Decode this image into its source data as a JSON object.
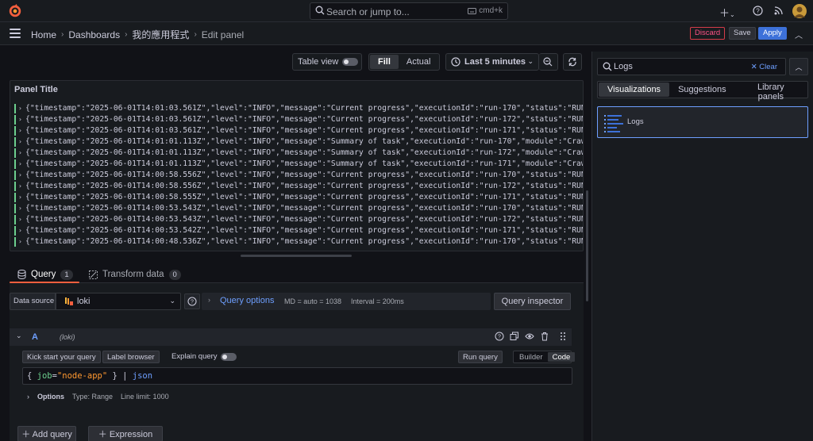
{
  "topbar": {
    "search_placeholder": "Search or jump to...",
    "search_shortcut": "cmd+k",
    "icons": [
      "grafana-logo-icon",
      "search-icon",
      "keyboard-icon",
      "plus-icon",
      "help-icon",
      "rss-icon",
      "avatar"
    ]
  },
  "breadcrumb": {
    "items": [
      "Home",
      "Dashboards",
      "我的應用程式",
      "Edit panel"
    ]
  },
  "actions": {
    "discard": "Discard",
    "save": "Save",
    "apply": "Apply"
  },
  "toolbar": {
    "table_view": "Table view",
    "fill": "Fill",
    "actual": "Actual",
    "time_range": "Last 5 minutes"
  },
  "panel": {
    "title": "Panel Title",
    "log_rows": [
      "{\"timestamp\":\"2025-06-01T14:01:03.561Z\",\"level\":\"INFO\",\"message\":\"Current progress\",\"executionId\":\"run-170\",\"status\":\"RUNNING\",\"module\":",
      "{\"timestamp\":\"2025-06-01T14:01:03.561Z\",\"level\":\"INFO\",\"message\":\"Current progress\",\"executionId\":\"run-172\",\"status\":\"RUNNING\",\"module\":",
      "{\"timestamp\":\"2025-06-01T14:01:03.561Z\",\"level\":\"INFO\",\"message\":\"Current progress\",\"executionId\":\"run-171\",\"status\":\"RUNNING\",\"module\":",
      "{\"timestamp\":\"2025-06-01T14:01:01.113Z\",\"level\":\"INFO\",\"message\":\"Summary of task\",\"executionId\":\"run-170\",\"module\":\"Crawler-C\",\"numToPr",
      "{\"timestamp\":\"2025-06-01T14:01:01.113Z\",\"level\":\"INFO\",\"message\":\"Summary of task\",\"executionId\":\"run-172\",\"module\":\"Crawler-B\",\"numToPr",
      "{\"timestamp\":\"2025-06-01T14:01:01.113Z\",\"level\":\"INFO\",\"message\":\"Summary of task\",\"executionId\":\"run-171\",\"module\":\"Crawler-A\",\"numToPr",
      "{\"timestamp\":\"2025-06-01T14:00:58.556Z\",\"level\":\"INFO\",\"message\":\"Current progress\",\"executionId\":\"run-170\",\"status\":\"RUNNING\",\"module\":",
      "{\"timestamp\":\"2025-06-01T14:00:58.556Z\",\"level\":\"INFO\",\"message\":\"Current progress\",\"executionId\":\"run-172\",\"status\":\"RUNNING\",\"module\":",
      "{\"timestamp\":\"2025-06-01T14:00:58.555Z\",\"level\":\"INFO\",\"message\":\"Current progress\",\"executionId\":\"run-171\",\"status\":\"RUNNING\",\"module\":",
      "{\"timestamp\":\"2025-06-01T14:00:53.543Z\",\"level\":\"INFO\",\"message\":\"Current progress\",\"executionId\":\"run-170\",\"status\":\"RUNNING\",\"module\":",
      "{\"timestamp\":\"2025-06-01T14:00:53.543Z\",\"level\":\"INFO\",\"message\":\"Current progress\",\"executionId\":\"run-172\",\"status\":\"RUNNING\",\"module\":",
      "{\"timestamp\":\"2025-06-01T14:00:53.542Z\",\"level\":\"INFO\",\"message\":\"Current progress\",\"executionId\":\"run-171\",\"status\":\"RUNNING\",\"module\":",
      "{\"timestamp\":\"2025-06-01T14:00:48.536Z\",\"level\":\"INFO\",\"message\":\"Current progress\",\"executionId\":\"run-170\",\"status\":\"RUNNING\",\"module\":"
    ]
  },
  "tabs": {
    "query": {
      "label": "Query",
      "count": "1"
    },
    "transform": {
      "label": "Transform data",
      "count": "0"
    }
  },
  "query_bar": {
    "data_source_label": "Data source",
    "data_source": "loki",
    "query_options": "Query options",
    "md": "MD = auto = 1038",
    "interval": "Interval = 200ms",
    "query_inspector": "Query inspector"
  },
  "query_row": {
    "name": "A",
    "datasource": "(loki)",
    "kick_start": "Kick start your query",
    "label_browser": "Label browser",
    "explain_query": "Explain query",
    "run_query": "Run query",
    "builder": "Builder",
    "code": "Code",
    "expr": {
      "open": "{ ",
      "key": "job",
      "op": "=",
      "value": "\"node-app\"",
      "close": " } | ",
      "fn": "json"
    },
    "options_label": "Options",
    "type": "Type: Range",
    "line_limit": "Line limit: 1000"
  },
  "bottom": {
    "add_query": "Add query",
    "expression": "Expression"
  },
  "viz_picker": {
    "search_value": "Logs",
    "clear": "Clear",
    "tabs": [
      "Visualizations",
      "Suggestions",
      "Library panels"
    ],
    "result": "Logs"
  },
  "colors": {
    "accent_blue": "#6e9fff",
    "apply_blue": "#3d71d9",
    "discard_red": "#ff5286",
    "tab_underline": "#f55f3e",
    "log_info_bar": "#6ccf8e"
  }
}
